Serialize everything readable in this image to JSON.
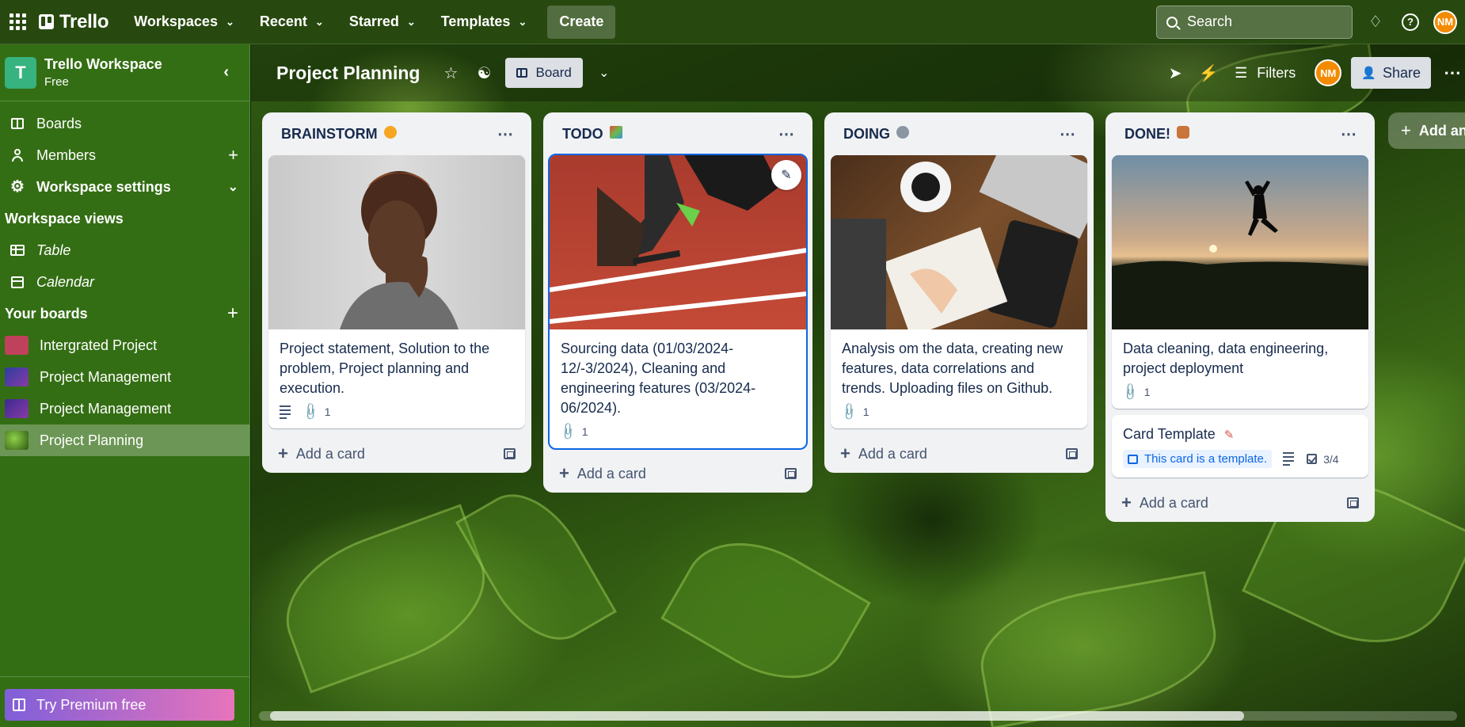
{
  "topbar": {
    "logo": "Trello",
    "menus": [
      "Workspaces",
      "Recent",
      "Starred",
      "Templates"
    ],
    "create_label": "Create",
    "search_placeholder": "Search",
    "avatar_initials": "NM"
  },
  "sidebar": {
    "workspace_name": "Trello Workspace",
    "workspace_initial": "T",
    "workspace_plan": "Free",
    "items": [
      {
        "label": "Boards"
      },
      {
        "label": "Members"
      },
      {
        "label": "Workspace settings"
      }
    ],
    "views_heading": "Workspace views",
    "views": [
      {
        "label": "Table"
      },
      {
        "label": "Calendar"
      }
    ],
    "boards_heading": "Your boards",
    "boards": [
      {
        "label": "Intergrated Project",
        "color": "#c0415c"
      },
      {
        "label": "Project Management",
        "color": "#5b3aa8"
      },
      {
        "label": "Project Management",
        "color": "#6a3aa8"
      },
      {
        "label": "Project Planning",
        "color": "#4f8c2a",
        "active": true
      }
    ],
    "premium_label": "Try Premium free"
  },
  "board": {
    "title": "Project Planning",
    "view_label": "Board",
    "filters_label": "Filters",
    "avatar_initials": "NM",
    "share_label": "Share",
    "add_list_label": "Add an",
    "add_card_label": "Add a card"
  },
  "lists": [
    {
      "title": "BRAINSTORM",
      "emoji_color": "#f6a623",
      "cards": [
        {
          "title": "Project statement, Solution to the problem, Project planning and execution.",
          "has_description": true,
          "attachments": "1",
          "cover": "brainstorm"
        }
      ]
    },
    {
      "title": "TODO",
      "emoji_color": "#6bb84d",
      "cards": [
        {
          "title": "Sourcing data (01/03/2024-12/-3/2024), Cleaning and engineering features (03/2024-06/2024).",
          "attachments": "1",
          "cover": "todo"
        }
      ]
    },
    {
      "title": "DOING",
      "emoji_color": "#8b96a3",
      "cards": [
        {
          "title": "Analysis om the data, creating new features, data correlations and trends. Uploading files on Github.",
          "attachments": "1",
          "cover": "doing"
        }
      ]
    },
    {
      "title": "DONE!",
      "emoji_color": "#c9743a",
      "cards": [
        {
          "title": "Data cleaning, data engineering, project deployment",
          "attachments": "1",
          "cover": "done"
        },
        {
          "title": "Card Template",
          "template_label": "This card is a template.",
          "checklist": "3/4"
        }
      ]
    }
  ],
  "colors": {
    "topbar_bg": "#27490f",
    "sidebar_bg": "#346e14",
    "accent_blue": "#0c66e4",
    "avatar": "#f38b00"
  }
}
